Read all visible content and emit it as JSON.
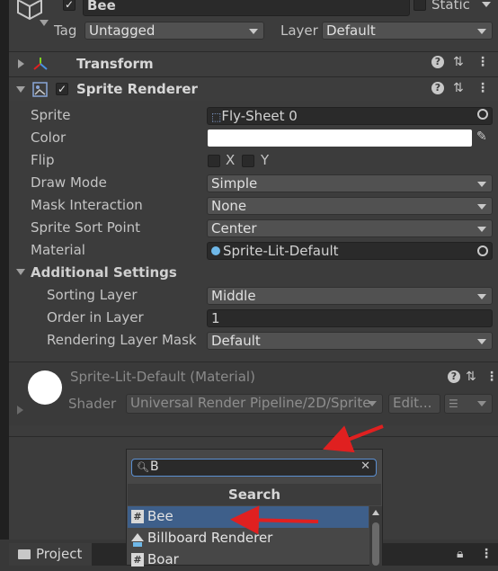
{
  "header": {
    "object_name": "Bee",
    "static_label": "Static",
    "tag_label": "Tag",
    "tag_value": "Untagged",
    "layer_label": "Layer",
    "layer_value": "Default"
  },
  "components": {
    "transform": {
      "title": "Transform"
    },
    "sprite_renderer": {
      "title": "Sprite Renderer",
      "props": {
        "sprite_label": "Sprite",
        "sprite_value": "Fly-Sheet 0",
        "color_label": "Color",
        "flip_label": "Flip",
        "flip_x": "X",
        "flip_y": "Y",
        "draw_mode_label": "Draw Mode",
        "draw_mode_value": "Simple",
        "mask_label": "Mask Interaction",
        "mask_value": "None",
        "sort_point_label": "Sprite Sort Point",
        "sort_point_value": "Center",
        "material_label": "Material",
        "material_value": "Sprite-Lit-Default"
      },
      "additional": {
        "title": "Additional Settings",
        "sorting_layer_label": "Sorting Layer",
        "sorting_layer_value": "Middle",
        "order_label": "Order in Layer",
        "order_value": "1",
        "rendering_mask_label": "Rendering Layer Mask",
        "rendering_mask_value": "Default"
      }
    },
    "material": {
      "title": "Sprite-Lit-Default (Material)",
      "shader_label": "Shader",
      "shader_value": "Universal Render Pipeline/2D/Sprite",
      "edit_label": "Edit..."
    }
  },
  "add_component_popup": {
    "search_text": "B",
    "header": "Search",
    "items": [
      {
        "label": "Bee",
        "icon": "#"
      },
      {
        "label": "Billboard Renderer",
        "icon": "billboard"
      },
      {
        "label": "Boar",
        "icon": "#"
      }
    ]
  },
  "bottom_tab": {
    "label": "Project"
  },
  "colors": {
    "selection": "#3e5f8a",
    "arrow": "#e02020",
    "sprite_color": "#ffffff"
  }
}
